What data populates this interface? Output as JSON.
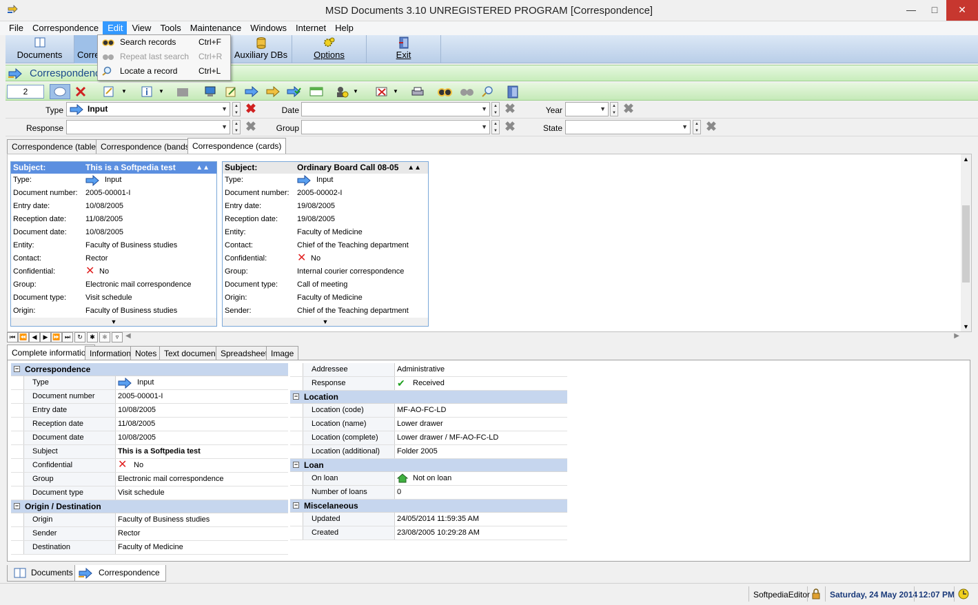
{
  "window": {
    "title": "MSD Documents 3.10 UNREGISTERED PROGRAM [Correspondence]"
  },
  "menu": [
    "File",
    "Correspondence",
    "Edit",
    "View",
    "Tools",
    "Maintenance",
    "Windows",
    "Internet",
    "Help"
  ],
  "big_toolbar": {
    "documents": "Documents",
    "correspondence": "Corre",
    "auxiliary": "Auxiliary DBs",
    "options": "Options",
    "exit": "Exit"
  },
  "edit_menu": {
    "items": [
      {
        "label": "Search records",
        "shortcut": "Ctrl+F"
      },
      {
        "label": "Repeat last search",
        "shortcut": "Ctrl+R"
      },
      {
        "label": "Locate a record",
        "shortcut": "Ctrl+L"
      }
    ]
  },
  "module_title": "Correspondence",
  "record_number": "2",
  "filters": {
    "type_label": "Type",
    "type_value": "Input",
    "date_label": "Date",
    "year_label": "Year",
    "response_label": "Response",
    "group_label": "Group",
    "state_label": "State"
  },
  "view_tabs": [
    "Correspondence (table)",
    "Correspondence (bands)",
    "Correspondence (cards)"
  ],
  "cards": [
    {
      "subject_label": "Subject:",
      "subject": "This is a Softpedia test",
      "rows": [
        [
          "Type:",
          "Input"
        ],
        [
          "Document number:",
          "2005-00001-I"
        ],
        [
          "Entry date:",
          "10/08/2005"
        ],
        [
          "Reception date:",
          "11/08/2005"
        ],
        [
          "Document date:",
          "10/08/2005"
        ],
        [
          "Entity:",
          "Faculty of Business studies"
        ],
        [
          "Contact:",
          "Rector"
        ],
        [
          "Confidential:",
          "No"
        ],
        [
          "Group:",
          "Electronic mail correspondence"
        ],
        [
          "Document type:",
          "Visit schedule"
        ],
        [
          "Origin:",
          "Faculty of Business studies"
        ]
      ]
    },
    {
      "subject_label": "Subject:",
      "subject": "Ordinary Board Call 08-05",
      "rows": [
        [
          "Type:",
          "Input"
        ],
        [
          "Document number:",
          "2005-00002-I"
        ],
        [
          "Entry date:",
          "19/08/2005"
        ],
        [
          "Reception date:",
          "19/08/2005"
        ],
        [
          "Entity:",
          "Faculty of Medicine"
        ],
        [
          "Contact:",
          "Chief of the Teaching department"
        ],
        [
          "Confidential:",
          "No"
        ],
        [
          "Group:",
          "Internal courier correspondence"
        ],
        [
          "Document type:",
          "Call of meeting"
        ],
        [
          "Origin:",
          "Faculty of Medicine"
        ],
        [
          "Sender:",
          "Chief of the Teaching department"
        ]
      ]
    }
  ],
  "detail_tabs": [
    "Complete information",
    "Information",
    "Notes",
    "Text document",
    "Spreadsheet",
    "Image"
  ],
  "left_grid": {
    "sec1": "Correspondence",
    "rows1": [
      [
        "Type",
        "Input"
      ],
      [
        "Document number",
        "2005-00001-I"
      ],
      [
        "Entry date",
        "10/08/2005"
      ],
      [
        "Reception date",
        "11/08/2005"
      ],
      [
        "Document date",
        "10/08/2005"
      ],
      [
        "Subject",
        "This is a Softpedia test"
      ],
      [
        "Confidential",
        "No"
      ],
      [
        "Group",
        "Electronic mail correspondence"
      ],
      [
        "Document type",
        "Visit schedule"
      ]
    ],
    "sec2": "Origin / Destination",
    "rows2": [
      [
        "Origin",
        "Faculty of Business studies"
      ],
      [
        "Sender",
        "Rector"
      ],
      [
        "Destination",
        "Faculty of Medicine"
      ]
    ]
  },
  "right_grid": {
    "rows0": [
      [
        "Addressee",
        "Administrative"
      ],
      [
        "Response",
        "Received"
      ]
    ],
    "sec1": "Location",
    "rows1": [
      [
        "Location (code)",
        "MF-AO-FC-LD"
      ],
      [
        "Location (name)",
        "Lower drawer"
      ],
      [
        "Location (complete)",
        "Lower drawer / MF-AO-FC-LD"
      ],
      [
        "Location (additional)",
        "Folder 2005"
      ]
    ],
    "sec2": "Loan",
    "rows2": [
      [
        "On loan",
        "Not on loan"
      ],
      [
        "Number of loans",
        "0"
      ]
    ],
    "sec3": "Miscelaneous",
    "rows3": [
      [
        "Updated",
        "24/05/2014 11:59:35 AM"
      ],
      [
        "Created",
        "23/08/2005 10:29:28 AM"
      ]
    ]
  },
  "bottom_tabs": [
    "Documents",
    "Correspondence"
  ],
  "status": {
    "user": "SoftpediaEditor",
    "date": "Saturday, 24 May 2014",
    "time": "12:07 PM"
  }
}
